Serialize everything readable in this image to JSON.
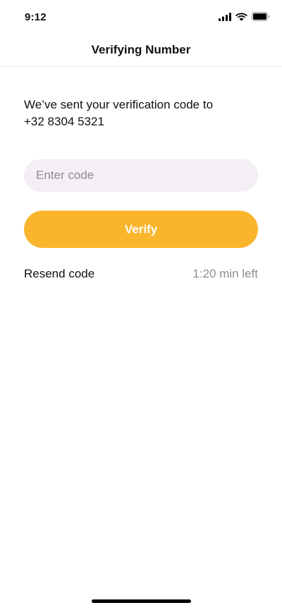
{
  "status_bar": {
    "time": "9:12",
    "icons": [
      "cellular-signal-icon",
      "wifi-icon",
      "battery-icon"
    ]
  },
  "header": {
    "title": "Verifying Number"
  },
  "main": {
    "message_line1": "We’ve sent your verification code to",
    "phone_number": "+32 8304 5321",
    "code_input": {
      "value": "",
      "placeholder": "Enter code"
    },
    "verify_label": "Verify",
    "resend_label": "Resend code",
    "time_left": "1:20 min left"
  },
  "colors": {
    "accent": "#fbb52d",
    "input_background": "#f3eff5",
    "muted_text": "#8e8c93"
  }
}
